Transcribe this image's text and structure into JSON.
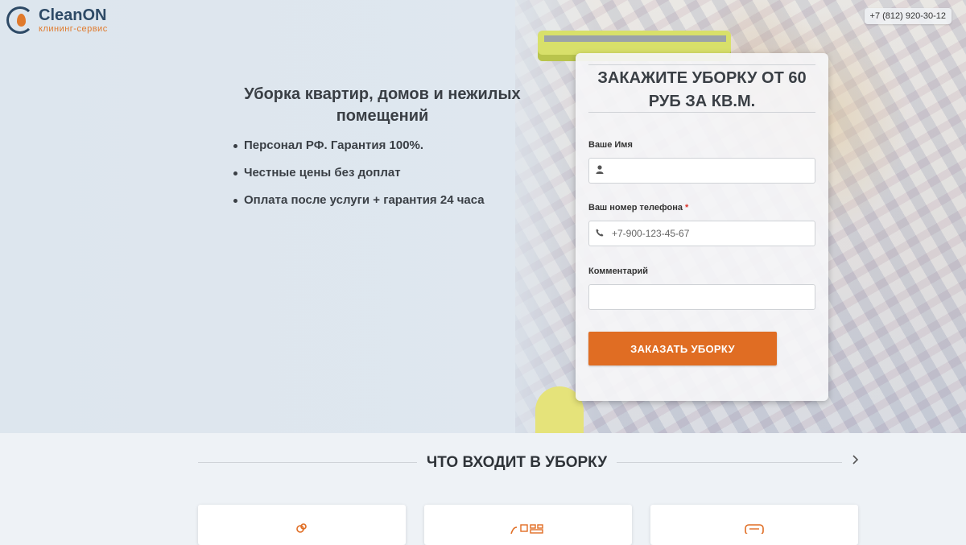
{
  "brand": {
    "name": "CleanON",
    "tagline": "клининг-сервис"
  },
  "header": {
    "phone": "+7 (812) 920-30-12"
  },
  "hero": {
    "headline": "Уборка квартир, домов и нежилых помещений",
    "bullets": [
      "Персонал РФ. Гарантия 100%.",
      "Честные цены без доплат",
      "Оплата после услуги + гарантия 24 часа"
    ]
  },
  "form": {
    "title": "ЗАКАЖИТЕ УБОРКУ ОТ 60 РУБ ЗА КВ.М.",
    "name_label": "Ваше Имя",
    "name_value": "",
    "phone_label": "Ваш номер телефона",
    "phone_required_mark": "*",
    "phone_placeholder": "+7-900-123-45-67",
    "comment_label": "Комментарий",
    "comment_value": "",
    "submit_label": "ЗАКАЗАТЬ УБОРКУ"
  },
  "services": {
    "title": "ЧТО ВХОДИТ В УБОРКУ",
    "next_icon": "chevron-right-icon",
    "cards": [
      {
        "icon": "cleaning-tools-icon"
      },
      {
        "icon": "broom-icon"
      },
      {
        "icon": "appliance-icon"
      }
    ]
  },
  "colors": {
    "accent": "#e06d23",
    "brand_dark": "#2e4a66",
    "text": "#3a3f45"
  }
}
